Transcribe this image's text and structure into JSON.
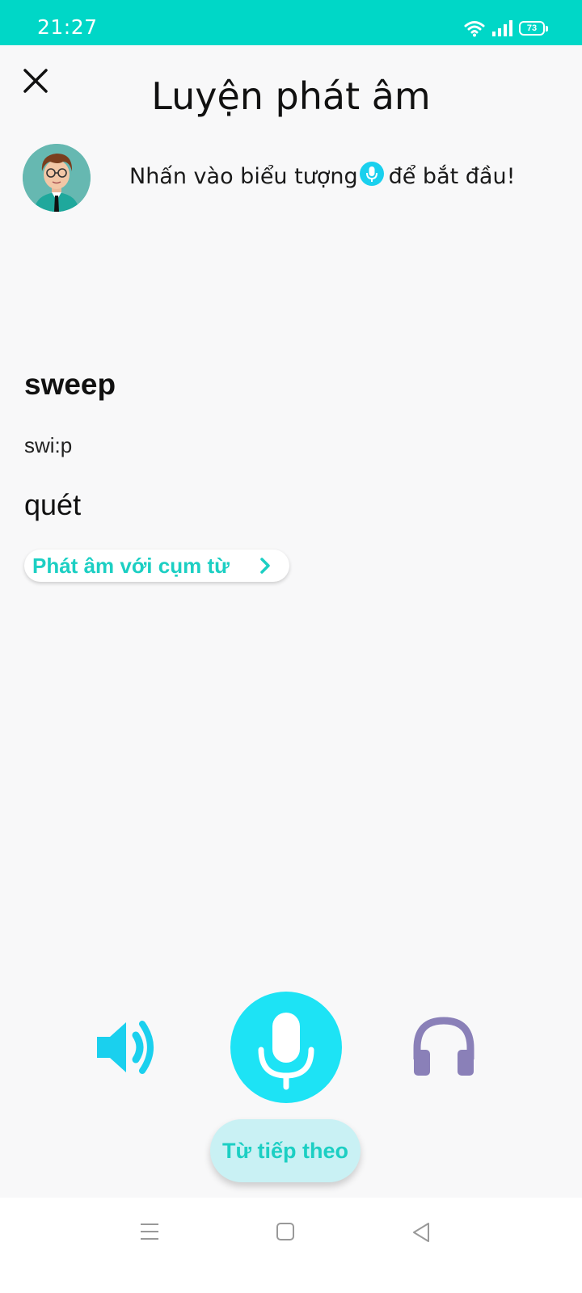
{
  "status_bar": {
    "time": "21:27",
    "battery": "73",
    "icons": [
      "wifi-icon",
      "signal-icon",
      "battery-icon"
    ]
  },
  "header": {
    "title": "Luyện phát âm",
    "close_icon": "close-icon"
  },
  "instruction": {
    "before": "Nhấn vào biểu tượng",
    "after": " để bắt đầu!",
    "icon": "mic-icon"
  },
  "card": {
    "word": "sweep",
    "ipa": "swi:p",
    "meaning": "quét",
    "phrase_button": "Phát âm với cụm từ"
  },
  "controls": {
    "speaker_icon": "speaker-icon",
    "mic_icon": "mic-icon",
    "headphones_icon": "headphones-icon",
    "next_button": "Từ tiếp theo"
  },
  "colors": {
    "status_bar": "#00d7c7",
    "accent": "#1ccfc3",
    "mic": "#1de3f5",
    "speaker": "#1ad0ee",
    "headphones": "#8a80b8",
    "next_bg": "#c9f1f4"
  },
  "nav_bar": {
    "icons": [
      "menu-icon",
      "home-icon",
      "back-icon"
    ]
  }
}
